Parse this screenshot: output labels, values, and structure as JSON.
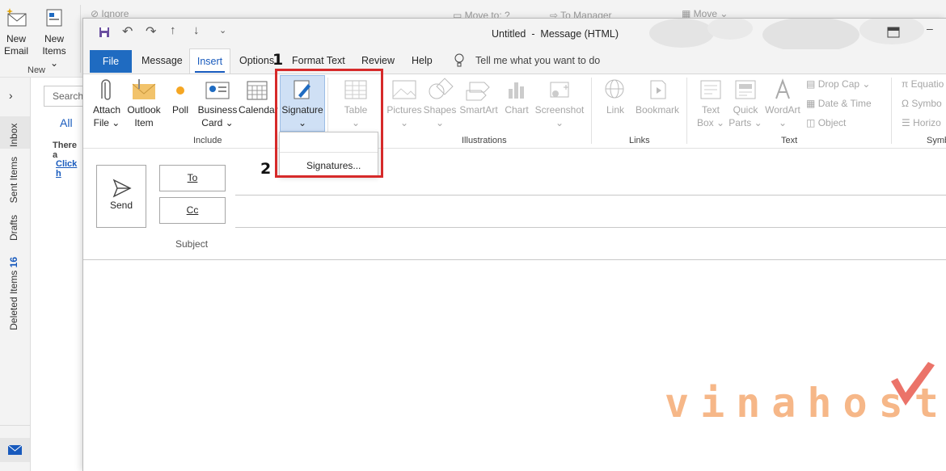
{
  "background_app": {
    "new_email": [
      "New",
      "Email"
    ],
    "new_items": [
      "New",
      "Items"
    ],
    "group_new": "New",
    "ignore": "Ignore",
    "move_to": "Move to: ?",
    "to_manager": "To Manager",
    "move": "Move",
    "search_placeholder": "Search",
    "filter_all": "All",
    "there_are": "There a",
    "click_here": "Click h",
    "folders": {
      "inbox": "Inbox",
      "sent": "Sent Items",
      "drafts": "Drafts",
      "deleted": "Deleted Items",
      "deleted_count": "16"
    }
  },
  "compose": {
    "title": "Untitled  -  Message (HTML)",
    "tabs": [
      "File",
      "Message",
      "Insert",
      "Options",
      "Format Text",
      "Review",
      "Help"
    ],
    "tell_me": "Tell me what you want to do",
    "ribbon": {
      "include": {
        "label": "Include",
        "attach_file": [
          "Attach",
          "File"
        ],
        "outlook_item": [
          "Outlook",
          "Item"
        ],
        "poll": "Poll",
        "business_card": [
          "Business",
          "Card"
        ],
        "calendar": "Calendar",
        "signature": "Signature"
      },
      "tables": {
        "table": "Table"
      },
      "illustrations": {
        "label": "Illustrations",
        "pictures": "Pictures",
        "shapes": "Shapes",
        "smartart": "SmartArt",
        "chart": "Chart",
        "screenshot": "Screenshot"
      },
      "links": {
        "label": "Links",
        "link": "Link",
        "bookmark": "Bookmark"
      },
      "text": {
        "label": "Text",
        "text_box": [
          "Text",
          "Box"
        ],
        "quick_parts": [
          "Quick",
          "Parts"
        ],
        "wordart": "WordArt",
        "drop_cap": "Drop Cap",
        "date_time": "Date & Time",
        "object": "Object"
      },
      "symbols": {
        "label": "Symb",
        "equation": "Equatio",
        "symbol": "Symbo",
        "horizontal": "Horizo"
      }
    },
    "send": "Send",
    "to": "To",
    "cc": "Cc",
    "subject": "Subject",
    "dropdown": {
      "signatures": "Signatures..."
    }
  },
  "annotations": {
    "step1": "1",
    "step2": "2"
  },
  "watermark": "vinahost."
}
